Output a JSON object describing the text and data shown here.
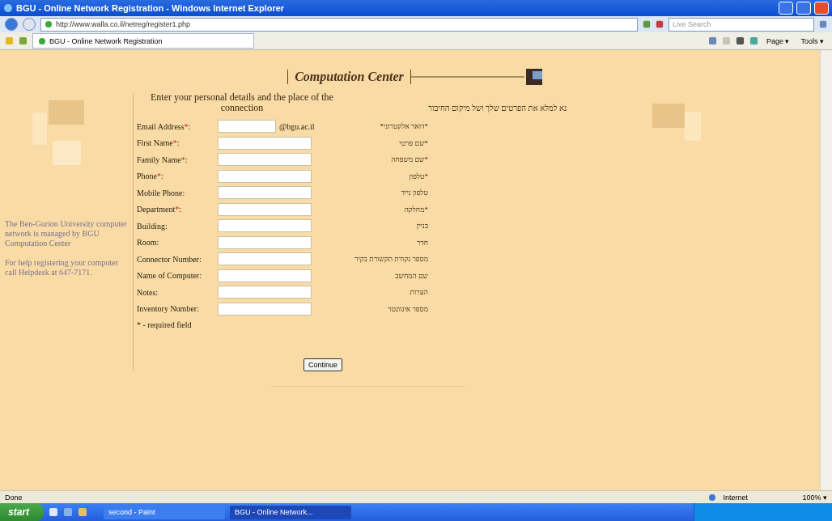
{
  "window": {
    "title": "BGU - Online Network Registration - Windows Internet Explorer"
  },
  "address_bar": {
    "url": "http://www.walla.co.il/netreg/register1.php",
    "search_placeholder": "Live Search"
  },
  "tab": {
    "label": "BGU - Online Network Registration",
    "selected": true
  },
  "command_bar": [
    {
      "label": "Page",
      "caret": "▾"
    },
    {
      "label": "Tools",
      "caret": "▾"
    }
  ],
  "page": {
    "banner": "Computation Center",
    "sidebar_paragraphs": [
      "The Ben-Gurion University computer network is managed by BGU Computation Center",
      "For help registering your computer call Helpdesk at 647-7171."
    ],
    "heading": "Enter your personal details and the place of the connection",
    "heading_hebrew": "נא למלא את הפרטים שלך ושל מיקום החיבור",
    "fields": [
      {
        "label": "Email Address",
        "mark": "*",
        "colon": ":",
        "suffix": "@bgu.ac.il",
        "hebrew": "*דואר אלקטרוני*"
      },
      {
        "label": "First Name",
        "mark": "*",
        "colon": ":",
        "hebrew": "*שם פרטי"
      },
      {
        "label": "Family Name",
        "mark": "*",
        "colon": ":",
        "hebrew": "*שם משפחה"
      },
      {
        "label": "Phone",
        "mark": "*",
        "colon": ":",
        "hebrew": "*טלפון"
      },
      {
        "label": "Mobile Phone",
        "colon": ":",
        "hebrew": "טלפון נייד"
      },
      {
        "label": "Department",
        "mark": "*",
        "colon": ":",
        "hebrew": "*מחלקה"
      },
      {
        "label": "Building",
        "colon": ":",
        "hebrew": "בניין"
      },
      {
        "label": "Room",
        "colon": ":",
        "hebrew": "חדר"
      },
      {
        "label": "Connector Number",
        "colon": ":",
        "hebrew": "מספר נקודת תקשורת בקיר"
      },
      {
        "label": "Name of Computer",
        "colon": ":",
        "hebrew": "שם המחשב"
      },
      {
        "label": "Notes",
        "colon": ":",
        "hebrew": "הערות"
      },
      {
        "label": "Inventory Number",
        "colon": ":",
        "hebrew": "מספר אינוונטר"
      }
    ],
    "required_note": "* - required field",
    "submit": "Continue"
  },
  "status_bar": {
    "text": "Done",
    "zone": "Internet",
    "zoom": "100%",
    "zoom_caret": "▾"
  },
  "taskbar": {
    "start": "start",
    "tasks": [
      {
        "label": "second - Paint",
        "selected": false
      },
      {
        "label": "BGU - Online Network...",
        "selected": true
      }
    ]
  }
}
